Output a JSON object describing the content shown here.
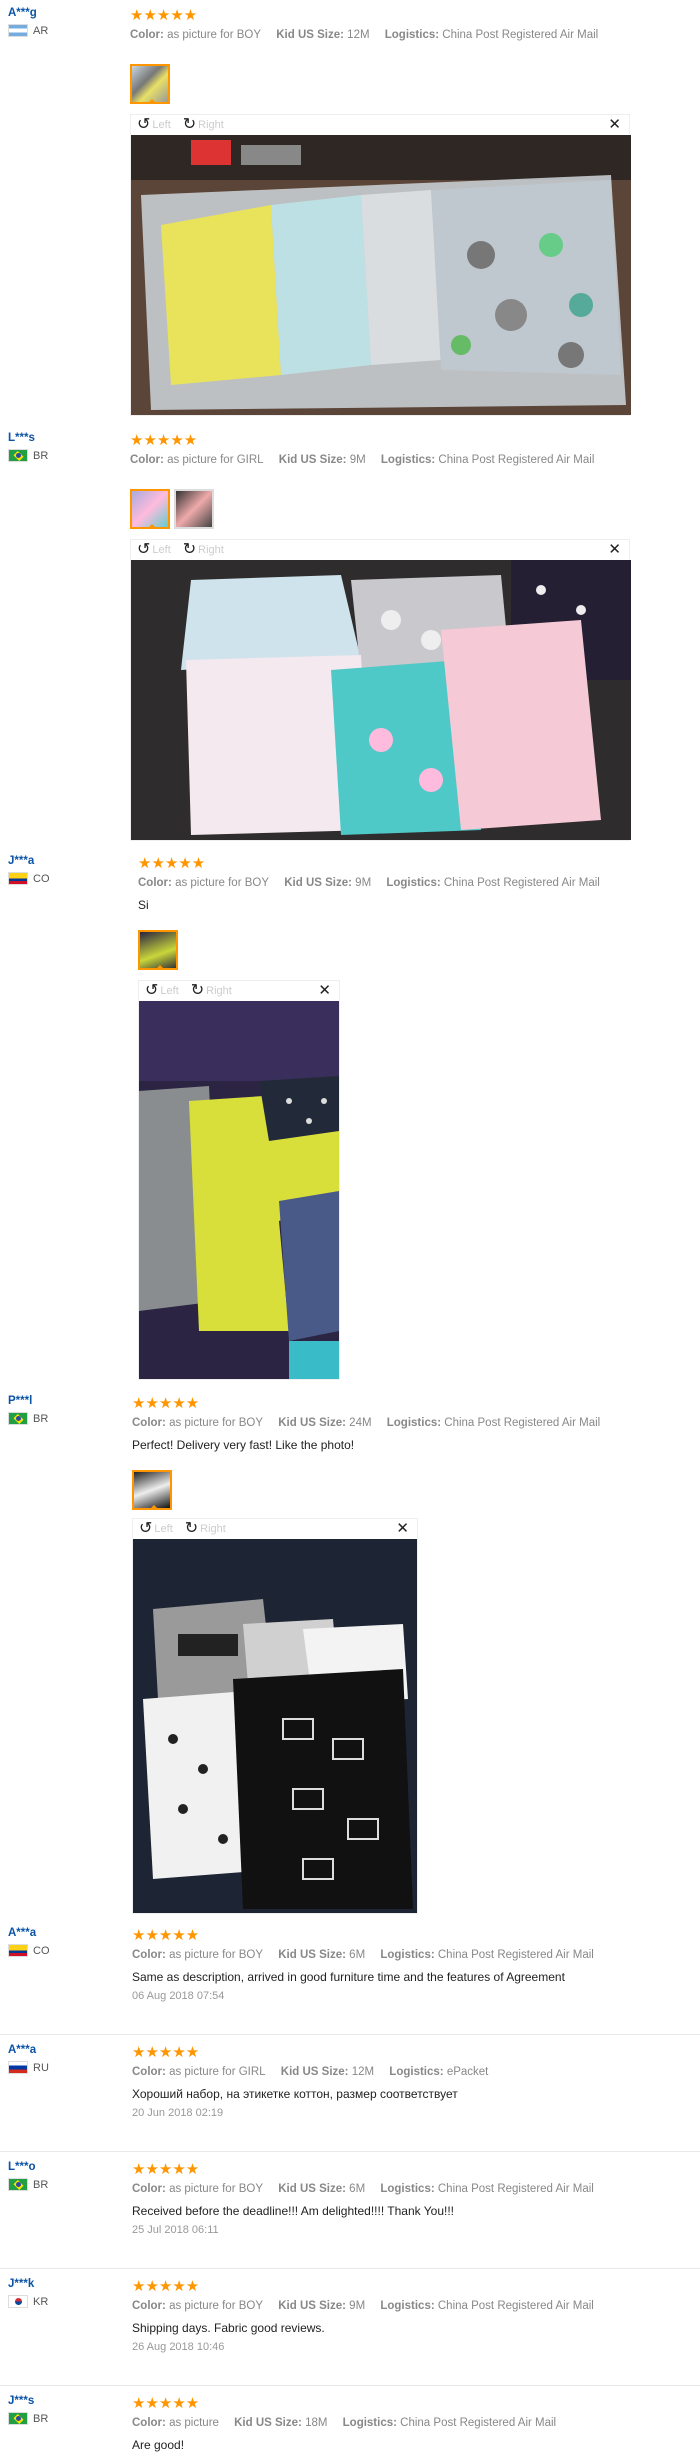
{
  "labels": {
    "color": "Color:",
    "size": "Kid US Size:",
    "logistics": "Logistics:",
    "left": "Left",
    "right": "Right"
  },
  "stars": "★★★★★",
  "colors": {
    "star": "#ff9600",
    "username": "#0b53a5",
    "thumb_active": "#ff9600"
  },
  "reviews": [
    {
      "user": "A***g",
      "country": "AR",
      "color": "as picture for BOY",
      "size": "12M",
      "logistics": "China Post Registered Air Mail",
      "text": "",
      "date": "",
      "photos": 1,
      "selected_photo": 1
    },
    {
      "user": "L***s",
      "country": "BR",
      "color": "as picture for GIRL",
      "size": "9M",
      "logistics": "China Post Registered Air Mail",
      "text": "",
      "date": "",
      "photos": 2,
      "selected_photo": 1
    },
    {
      "user": "J***a",
      "country": "CO",
      "color": "as picture for BOY",
      "size": "9M",
      "logistics": "China Post Registered Air Mail",
      "text": "Si",
      "date": "",
      "photos": 1,
      "selected_photo": 1
    },
    {
      "user": "P***l",
      "country": "BR",
      "color": "as picture for BOY",
      "size": "24M",
      "logistics": "China Post Registered Air Mail",
      "text": "Perfect! Delivery very fast! Like the photo!",
      "date": "",
      "photos": 1,
      "selected_photo": 1
    },
    {
      "user": "A***a",
      "country": "CO",
      "color": "as picture for BOY",
      "size": "6M",
      "logistics": "China Post Registered Air Mail",
      "text": "Same as description, arrived in good furniture time and the features of Agreement",
      "date": "06 Aug 2018 07:54"
    },
    {
      "user": "A***a",
      "country": "RU",
      "color": "as picture for GIRL",
      "size": "12M",
      "logistics": "ePacket",
      "text": "Хороший набор, на этикетке коттон, размер соответствует",
      "date": "20 Jun 2018 02:19"
    },
    {
      "user": "L***o",
      "country": "BR",
      "color": "as picture for BOY",
      "size": "6M",
      "logistics": "China Post Registered Air Mail",
      "text": "Received before the deadline!!! Am delighted!!!! Thank You!!!",
      "date": "25 Jul 2018 06:11"
    },
    {
      "user": "J***k",
      "country": "KR",
      "color": "as picture for BOY",
      "size": "9M",
      "logistics": "China Post Registered Air Mail",
      "text": "Shipping days. Fabric good reviews.",
      "date": "26 Aug 2018 10:46"
    },
    {
      "user": "J***s",
      "country": "BR",
      "color": "as picture",
      "size": "18M",
      "logistics": "China Post Registered Air Mail",
      "text": "Are good!",
      "date": ""
    }
  ]
}
